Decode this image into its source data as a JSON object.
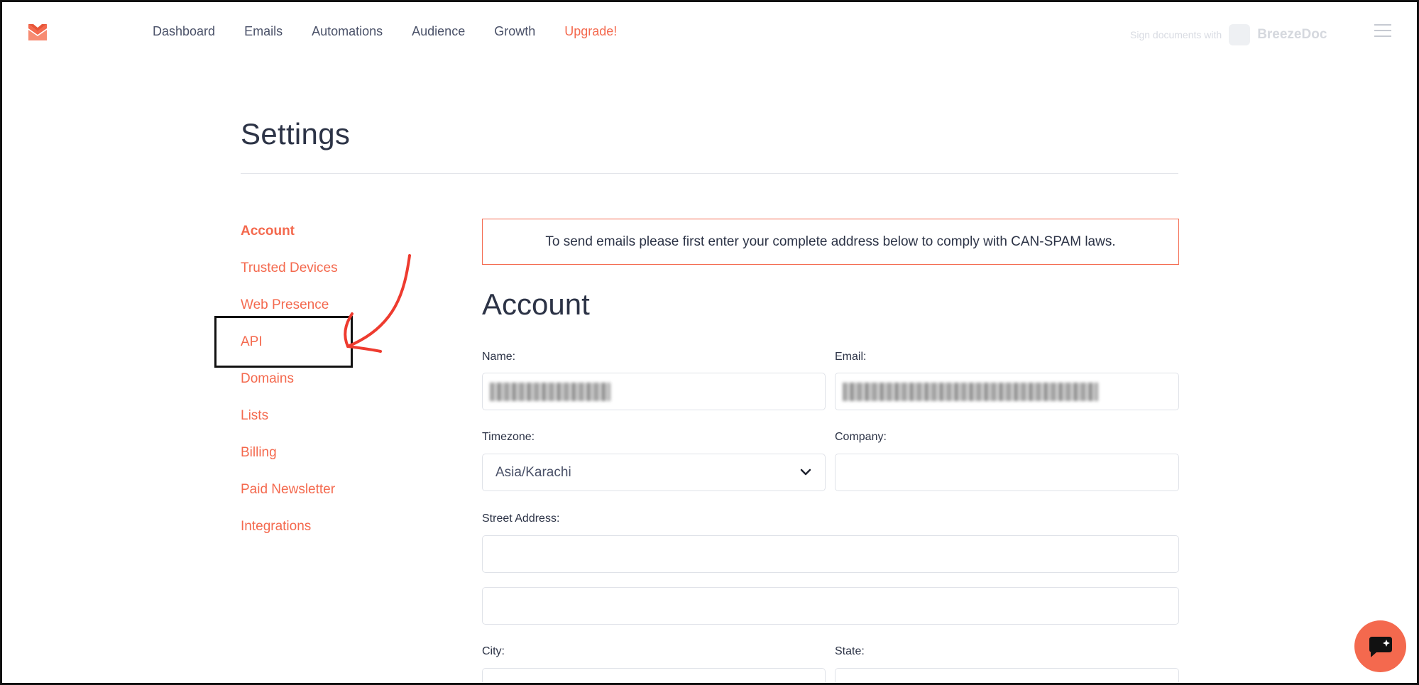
{
  "nav": {
    "items": [
      {
        "label": "Dashboard"
      },
      {
        "label": "Emails"
      },
      {
        "label": "Automations"
      },
      {
        "label": "Audience"
      },
      {
        "label": "Growth"
      }
    ],
    "upgrade_label": "Upgrade!",
    "sign_docs_label": "Sign documents with",
    "brand_label": "BreezeDoc"
  },
  "page": {
    "title": "Settings"
  },
  "side_menu": {
    "items": [
      {
        "label": "Account"
      },
      {
        "label": "Trusted Devices"
      },
      {
        "label": "Web Presence"
      },
      {
        "label": "API"
      },
      {
        "label": "Domains"
      },
      {
        "label": "Lists"
      },
      {
        "label": "Billing"
      },
      {
        "label": "Paid Newsletter"
      },
      {
        "label": "Integrations"
      }
    ]
  },
  "main": {
    "notice": "To send emails please first enter your complete address below to comply with CAN-SPAM laws.",
    "section_title": "Account",
    "labels": {
      "name": "Name:",
      "email": "Email:",
      "timezone": "Timezone:",
      "company": "Company:",
      "street": "Street Address:",
      "city": "City:",
      "state": "State:"
    },
    "timezone_value": "Asia/Karachi"
  },
  "colors": {
    "accent": "#f4694e",
    "text": "#2c3346",
    "border": "#dfe2e8"
  },
  "icons": {
    "logo": "mail-logo-icon",
    "menu": "hamburger-menu-icon",
    "chat": "chat-bubble-icon",
    "select": "chevron-down-icon",
    "annotation": "red-arrow-icon"
  }
}
